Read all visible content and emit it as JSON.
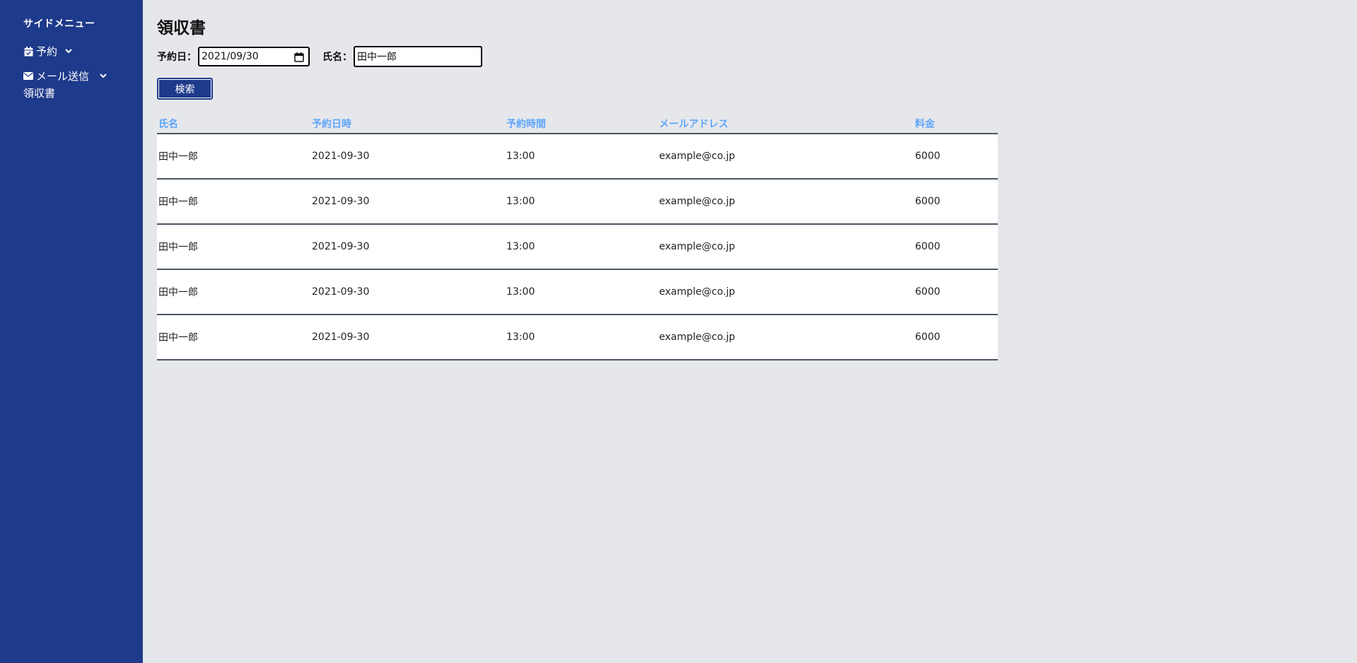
{
  "sidebar": {
    "title": "サイドメニュー",
    "items": [
      {
        "icon": "calendar-check-icon",
        "label": "予約"
      },
      {
        "icon": "envelope-icon",
        "label": "メール送信"
      }
    ],
    "sub_item": "領収書"
  },
  "main": {
    "title": "領収書",
    "filters": {
      "date_label": "予約日：",
      "date_value": "2021/09/30",
      "name_label": "氏名：",
      "name_value": "田中一郎"
    },
    "search_button": "検索",
    "table": {
      "headers": [
        "氏名",
        "予約日時",
        "予約時間",
        "メールアドレス",
        "料金"
      ],
      "rows": [
        [
          "田中一郎",
          "2021-09-30",
          "13:00",
          "example@co.jp",
          "6000"
        ],
        [
          "田中一郎",
          "2021-09-30",
          "13:00",
          "example@co.jp",
          "6000"
        ],
        [
          "田中一郎",
          "2021-09-30",
          "13:00",
          "example@co.jp",
          "6000"
        ],
        [
          "田中一郎",
          "2021-09-30",
          "13:00",
          "example@co.jp",
          "6000"
        ],
        [
          "田中一郎",
          "2021-09-30",
          "13:00",
          "example@co.jp",
          "6000"
        ]
      ]
    }
  },
  "colors": {
    "sidebar_bg": "#1e3a8a",
    "page_bg": "#e5e7eb",
    "header_text": "#60a5fa",
    "button_bg": "#1e3a8a"
  }
}
